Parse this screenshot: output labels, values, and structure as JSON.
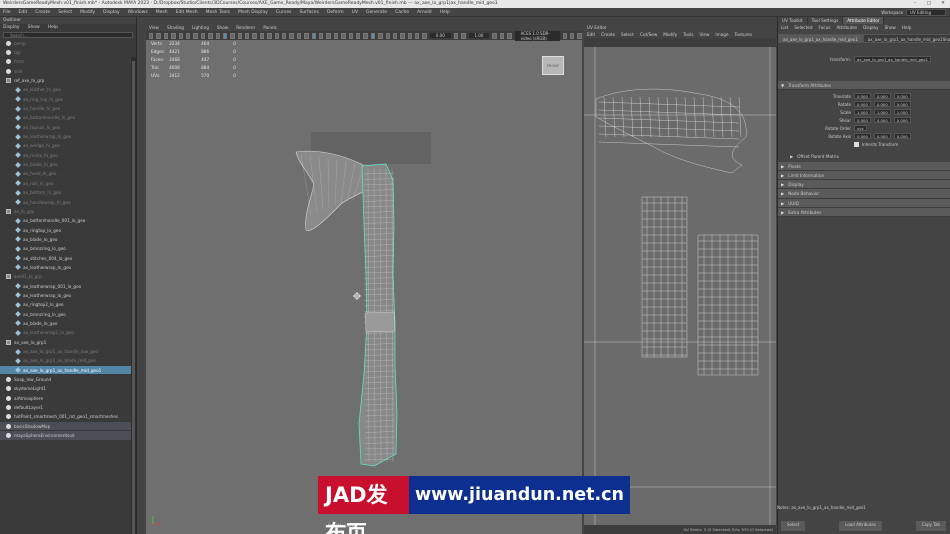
{
  "titlebar": {
    "text": "WeirdersGameReadyMesh.v01_finish.mb* - Autodesk MAYA 2023 - D:/Dropbox/Studio/Clients/3DCourses/Courses/AXE_Game_Ready/Maya/WeirdersGameReadyMesh.v01_finish.mb --- ax_axe_lo_grp1|ax_handle_mid_geo1",
    "minimize": "–",
    "maximize": "□",
    "close": "✕"
  },
  "menubar": {
    "items": [
      "File",
      "Edit",
      "Create",
      "Select",
      "Modify",
      "Display",
      "Windows",
      "Mesh",
      "Edit Mesh",
      "Mesh Tools",
      "Mesh Display",
      "Curves",
      "Surfaces",
      "Deform",
      "UV",
      "Generate",
      "Cache",
      "Arnold",
      "Help"
    ],
    "workspace_label": "Workspace",
    "workspace_value": "UV Editing"
  },
  "outliner": {
    "title": "Outliner",
    "menu": [
      "Display",
      "Show",
      "Help"
    ],
    "search_placeholder": "Search...",
    "rows": [
      {
        "label": "persp",
        "icon": "camera-icon",
        "style": "dim"
      },
      {
        "label": "top",
        "icon": "camera-icon",
        "style": "dim"
      },
      {
        "label": "front",
        "icon": "camera-icon",
        "style": "dim"
      },
      {
        "label": "side",
        "icon": "camera-icon",
        "style": "dim"
      },
      {
        "label": "ref_axe_hi_grp",
        "icon": "group-icon",
        "style": ""
      },
      {
        "label": "ax_leather_hi_geo",
        "icon": "mesh-icon",
        "style": "dim"
      },
      {
        "label": "ax_ring_top_hi_geo",
        "icon": "mesh-icon",
        "style": "dim"
      },
      {
        "label": "ax_handle_hi_geo",
        "icon": "mesh-icon",
        "style": "dim"
      },
      {
        "label": "ax_bottomhandle_hi_geo",
        "icon": "mesh-icon",
        "style": "dim"
      },
      {
        "label": "ax_topnail_hi_geo",
        "icon": "mesh-icon",
        "style": "dim"
      },
      {
        "label": "ax_leatherwrap_hi_geo",
        "icon": "mesh-icon",
        "style": "dim"
      },
      {
        "label": "ax_wedge_hi_geo",
        "icon": "mesh-icon",
        "style": "dim"
      },
      {
        "label": "ax_rivets_hi_geo",
        "icon": "mesh-icon",
        "style": "dim"
      },
      {
        "label": "ax_blade_hi_geo",
        "icon": "mesh-icon",
        "style": "dim"
      },
      {
        "label": "ax_head_hi_geo",
        "icon": "mesh-icon",
        "style": "dim"
      },
      {
        "label": "ax_nail_hi_geo",
        "icon": "mesh-icon",
        "style": "dim"
      },
      {
        "label": "ax_bottom_hi_geo",
        "icon": "mesh-icon",
        "style": "dim"
      },
      {
        "label": "ax_handlewrap_hi_geo",
        "icon": "mesh-icon",
        "style": "dim"
      },
      {
        "label": "ax_lo_grp",
        "icon": "group-icon",
        "style": "dim"
      },
      {
        "label": "ax_bottomhandle_001_lo_geo",
        "icon": "mesh-icon",
        "style": ""
      },
      {
        "label": "ax_ringtop_lo_geo",
        "icon": "mesh-icon",
        "style": ""
      },
      {
        "label": "ax_blade_lo_geo",
        "icon": "mesh-icon",
        "style": ""
      },
      {
        "label": "ax_bronzring_lo_geo",
        "icon": "mesh-icon",
        "style": ""
      },
      {
        "label": "ax_stitches_004_lo_geo",
        "icon": "mesh-icon",
        "style": ""
      },
      {
        "label": "ax_leatherwrap_lo_geo",
        "icon": "mesh-icon",
        "style": ""
      },
      {
        "label": "axe01_lo_grp",
        "icon": "group-icon",
        "style": "dim"
      },
      {
        "label": "ax_leatherwrap_001_lo_geo",
        "icon": "mesh-icon",
        "style": ""
      },
      {
        "label": "ax_leatherwrap_lo_geo",
        "icon": "mesh-icon",
        "style": ""
      },
      {
        "label": "ax_ringtop2_lo_geo",
        "icon": "mesh-icon",
        "style": ""
      },
      {
        "label": "ax_bronzring_lo_geo",
        "icon": "mesh-icon",
        "style": ""
      },
      {
        "label": "ax_blade_lo_geo",
        "icon": "mesh-icon",
        "style": ""
      },
      {
        "label": "ax_leatherwrap2_lo_geo",
        "icon": "mesh-icon",
        "style": "dim"
      },
      {
        "label": "ax_axe_lo_grp1",
        "icon": "group-icon",
        "style": ""
      },
      {
        "label": "ax_axe_lo_grp1_ax_handle_low_geo",
        "icon": "mesh-icon",
        "style": "dim"
      },
      {
        "label": "ax_axe_lo_grp1_ax_blade_mid_geo",
        "icon": "mesh-icon",
        "style": "dim"
      },
      {
        "label": "ax_axe_lo_grp1_ax_handle_mid_geo1",
        "icon": "mesh-icon",
        "style": "sel"
      },
      {
        "label": "Soap_low_Ground",
        "icon": "light-icon",
        "style": ""
      },
      {
        "label": "skydomeLight1",
        "icon": "light-icon",
        "style": ""
      },
      {
        "label": "aiAtmosphere",
        "icon": "light-icon",
        "style": ""
      },
      {
        "label": "defaultLayer1",
        "icon": "light-icon",
        "style": ""
      },
      {
        "label": "hotPaint_smartmesh_001_rot_geo1_smartmeshes",
        "icon": "light-icon",
        "style": ""
      },
      {
        "label": "basicShadowMap",
        "icon": "light-icon",
        "style": "hl"
      },
      {
        "label": "mayaSphereEnvironmentsuit",
        "icon": "light-icon",
        "style": "hl"
      }
    ]
  },
  "viewport": {
    "menu": [
      "View",
      "Shading",
      "Lighting",
      "Show",
      "Renderer",
      "Panels"
    ],
    "toolbar_value_1": "0.00",
    "toolbar_value_2": "1.00",
    "toolbar_colorspace": "ACES 1.0 SDR-video (sRGB)",
    "hud": {
      "rows": [
        {
          "label": "Verts:",
          "a": "2234",
          "b": "464",
          "c": "0"
        },
        {
          "label": "Edges:",
          "a": "4421",
          "b": "886",
          "c": "0"
        },
        {
          "label": "Faces:",
          "a": "2468",
          "b": "447",
          "c": "0"
        },
        {
          "label": "Tris:",
          "a": "4008",
          "b": "884",
          "c": "0"
        },
        {
          "label": "UVs:",
          "a": "2412",
          "b": "570",
          "c": "0"
        }
      ]
    },
    "viewcube_label": "FRONT",
    "camera_label": "frontV : persp"
  },
  "uv_editor": {
    "title": "UV Editor",
    "menu": [
      "Edit",
      "Create",
      "Select",
      "Cut/Sew",
      "Modify",
      "Tools",
      "View",
      "Image",
      "Textures"
    ],
    "status": "UV Shells: 2 (0 Selected)  UVs: 570 (0 Selected)"
  },
  "attribute_editor": {
    "tabs": [
      "UV Toolkit",
      "Tool Settings",
      "Attribute Editor"
    ],
    "active_tab": "Attribute Editor",
    "menu": [
      "List",
      "Selected",
      "Focus",
      "Attributes",
      "Display",
      "Show",
      "Help"
    ],
    "node_tabs": [
      "ax_axe_lo_grp1_ax_handle_mid_geo1",
      "ax_axe_lo_grp1_ax_handle_mid_geo1Shape"
    ],
    "transform_label": "transform:",
    "transform_value": "ax_axe_lo_grp1_ax_handle_mid_geo1",
    "sections": {
      "transform_attributes": "Transform Attributes",
      "fields": [
        {
          "label": "Translate",
          "x": "0.000",
          "y": "0.000",
          "z": "0.000"
        },
        {
          "label": "Rotate",
          "x": "0.000",
          "y": "0.000",
          "z": "0.000"
        },
        {
          "label": "Scale",
          "x": "1.000",
          "y": "1.000",
          "z": "1.000"
        },
        {
          "label": "Shear",
          "x": "0.000",
          "y": "0.000",
          "z": "0.000"
        }
      ],
      "rotate_order_label": "Rotate Order",
      "rotate_order_value": "xyz",
      "rotate_axis_label": "Rotate Axis",
      "rotate_axis": [
        "0.000",
        "0.000",
        "0.000"
      ],
      "inherits_label": "Inherits Transform",
      "collapsed": [
        "Pivots",
        "Limit Information",
        "Display",
        "Node Behavior",
        "UUID",
        "Extra Attributes"
      ],
      "offset_parent": "Offset Parent Matrix"
    },
    "notes_label": "Notes:",
    "notes_value": "ax_axe_lo_grp1_ax_handle_mid_geo1",
    "buttons": [
      "Select",
      "Load Attributes",
      "Copy Tab"
    ]
  },
  "watermark": {
    "left": "JAD发布页",
    "right": "www.jiuandun.net.cn"
  }
}
